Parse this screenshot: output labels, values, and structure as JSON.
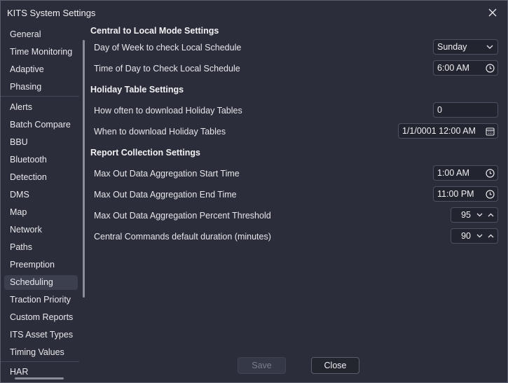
{
  "window": {
    "title": "KITS System Settings"
  },
  "sidebar": {
    "items": [
      {
        "label": "General",
        "selected": false
      },
      {
        "label": "Time Monitoring",
        "selected": false
      },
      {
        "label": "Adaptive",
        "selected": false
      },
      {
        "label": "Phasing",
        "selected": false
      },
      {
        "label": "Alerts",
        "selected": false
      },
      {
        "label": "Batch Compare",
        "selected": false
      },
      {
        "label": "BBU",
        "selected": false
      },
      {
        "label": "Bluetooth",
        "selected": false
      },
      {
        "label": "Detection",
        "selected": false
      },
      {
        "label": "DMS",
        "selected": false
      },
      {
        "label": "Map",
        "selected": false
      },
      {
        "label": "Network",
        "selected": false
      },
      {
        "label": "Paths",
        "selected": false
      },
      {
        "label": "Preemption",
        "selected": false
      },
      {
        "label": "Scheduling",
        "selected": true
      },
      {
        "label": "Traction Priority",
        "selected": false
      },
      {
        "label": "Custom Reports",
        "selected": false
      },
      {
        "label": "ITS Asset Types",
        "selected": false
      },
      {
        "label": "Timing Values",
        "selected": false
      },
      {
        "label": "HAR",
        "selected": false
      }
    ]
  },
  "sections": {
    "central_local": {
      "title": "Central to Local Mode Settings",
      "day_label": "Day of Week to check Local Schedule",
      "day_value": "Sunday",
      "time_label": "Time of Day to Check Local Schedule",
      "time_value": "6:00 AM"
    },
    "holiday": {
      "title": "Holiday Table Settings",
      "often_label": "How often to download Holiday Tables",
      "often_value": "0",
      "when_label": "When to download Holiday Tables",
      "when_value": "1/1/0001 12:00 AM"
    },
    "report": {
      "title": "Report Collection Settings",
      "start_label": "Max Out Data Aggregation Start Time",
      "start_value": "1:00 AM",
      "end_label": "Max Out Data Aggregation End Time",
      "end_value": "11:00 PM",
      "threshold_label": "Max Out Data Aggregation Percent Threshold",
      "threshold_value": "95",
      "duration_label": "Central Commands default duration (minutes)",
      "duration_value": "90"
    }
  },
  "buttons": {
    "save": "Save",
    "close": "Close"
  },
  "colors": {
    "background": "#2b2d3a",
    "field": "#22242f",
    "selected": "#3c3f4e"
  }
}
